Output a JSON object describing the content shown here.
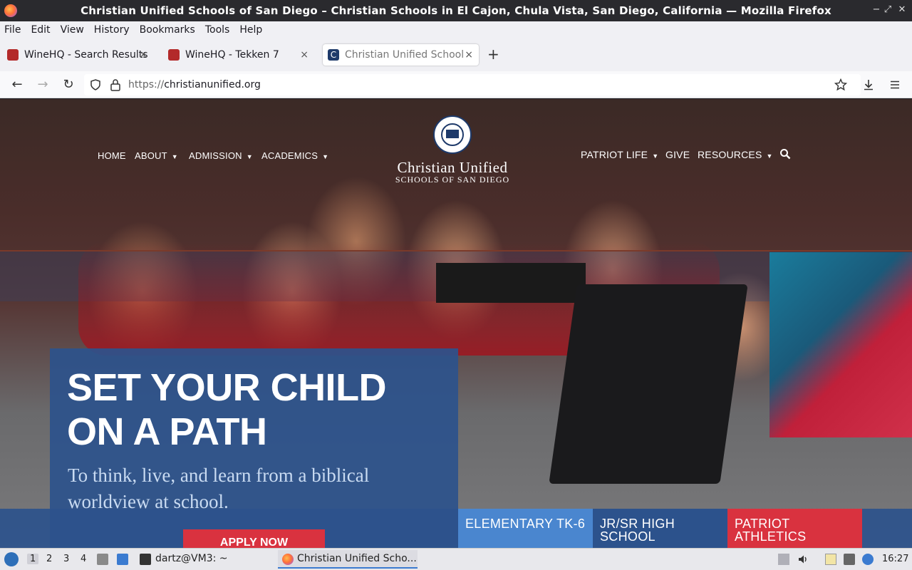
{
  "window": {
    "title": "Christian Unified Schools of San Diego – Christian Schools in El Cajon, Chula Vista, San Diego, California — Mozilla Firefox",
    "controls": [
      "−",
      "⤢",
      "✕"
    ]
  },
  "menu": [
    "File",
    "Edit",
    "View",
    "History",
    "Bookmarks",
    "Tools",
    "Help"
  ],
  "tabs": [
    {
      "label": "WineHQ - Search Results",
      "icon_color": "#b32a2a"
    },
    {
      "label": "WineHQ - Tekken 7",
      "icon_color": "#b32a2a"
    },
    {
      "label": "Christian Unified Schools",
      "icon_color": "#1e3a6a"
    }
  ],
  "newtab_label": "+",
  "nav": {
    "url_proto": "https://",
    "url_host": "christianunified.org",
    "back": "←",
    "forward": "→",
    "reload": "↻"
  },
  "site": {
    "nav_left": [
      {
        "label": "HOME",
        "caret": false
      },
      {
        "label": "ABOUT",
        "caret": true
      },
      {
        "label": "ADMISSION",
        "caret": true
      },
      {
        "label": "ACADEMICS",
        "caret": true
      }
    ],
    "nav_right": [
      {
        "label": "PATRIOT LIFE",
        "caret": true
      },
      {
        "label": "GIVE",
        "caret": false
      },
      {
        "label": "RESOURCES",
        "caret": true
      }
    ],
    "logo_name": "Christian Unified",
    "logo_sub": "SCHOOLS OF SAN DIEGO",
    "hero_title": "SET YOUR CHILD ON A PATH",
    "hero_sub": "To think, live, and learn from a biblical worldview at school.",
    "apply_label": "APPLY NOW",
    "cards": [
      {
        "label": "ELEMENTARY TK-6",
        "color": "#4a86cf"
      },
      {
        "label": "JR/SR HIGH SCHOOL",
        "color": "#2c528c"
      },
      {
        "label": "PATRIOT ATHLETICS",
        "color": "#d9323f"
      }
    ]
  },
  "taskbar": {
    "workspaces": [
      "1",
      "2",
      "3",
      "4"
    ],
    "terminal_label": "dartz@VM3: ~",
    "task_label": "Christian Unified Scho...",
    "clock": "16:27"
  }
}
